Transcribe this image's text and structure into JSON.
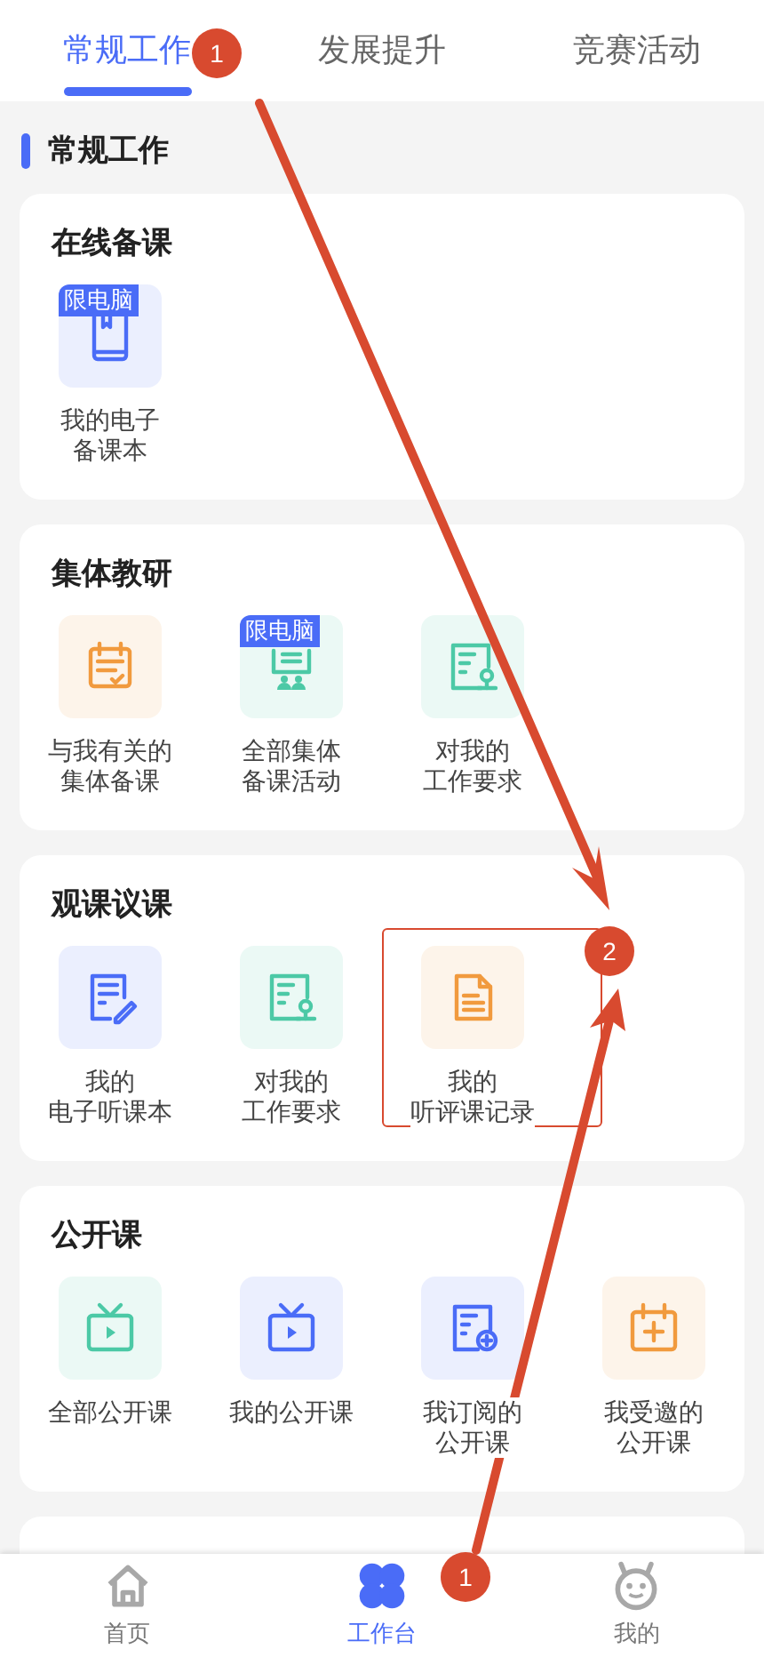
{
  "tabs": [
    {
      "label": "常规工作",
      "selected": true
    },
    {
      "label": "发展提升",
      "selected": false
    },
    {
      "label": "竞赛活动",
      "selected": false
    }
  ],
  "section_title": "常规工作",
  "cards": [
    {
      "title": "在线备课",
      "items": [
        {
          "kind": "book",
          "color": "#4a6cf7",
          "badge": "限电脑",
          "label_lines": [
            "我的电子",
            "备课本"
          ],
          "highlighted": false
        }
      ]
    },
    {
      "title": "集体教研",
      "items": [
        {
          "kind": "calendar-check",
          "color": "#f19a3e",
          "label_lines": [
            "与我有关的",
            "集体备课"
          ],
          "highlighted": false
        },
        {
          "kind": "meeting",
          "color": "#4cc9a6",
          "badge": "限电脑",
          "label_lines": [
            "全部集体",
            "备课活动"
          ],
          "highlighted": false
        },
        {
          "kind": "doc-person",
          "color": "#4cc9a6",
          "label_lines": [
            "对我的",
            "工作要求"
          ],
          "highlighted": false
        }
      ]
    },
    {
      "title": "观课议课",
      "items": [
        {
          "kind": "doc-edit",
          "color": "#4a6cf7",
          "label_lines": [
            "我的",
            "电子听课本"
          ],
          "highlighted": false
        },
        {
          "kind": "doc-person",
          "color": "#4cc9a6",
          "label_lines": [
            "对我的",
            "工作要求"
          ],
          "highlighted": false
        },
        {
          "kind": "doc",
          "color": "#f19a3e",
          "label_lines": [
            "我的",
            "听评课记录"
          ],
          "highlighted": true
        }
      ]
    },
    {
      "title": "公开课",
      "items": [
        {
          "kind": "tv",
          "color": "#4cc9a6",
          "label_lines": [
            "全部公开课"
          ],
          "highlighted": false
        },
        {
          "kind": "tv",
          "color": "#4a6cf7",
          "label_lines": [
            "我的公开课"
          ],
          "highlighted": false
        },
        {
          "kind": "doc-add",
          "color": "#4a6cf7",
          "label_lines": [
            "我订阅的",
            "公开课"
          ],
          "highlighted": false
        },
        {
          "kind": "calendar-add",
          "color": "#f19a3e",
          "label_lines": [
            "我受邀的",
            "公开课"
          ],
          "highlighted": false
        }
      ]
    }
  ],
  "bottom_nav": [
    {
      "kind": "home",
      "label": "首页",
      "selected": false
    },
    {
      "kind": "clover",
      "label": "工作台",
      "selected": true
    },
    {
      "kind": "face",
      "label": "我的",
      "selected": false
    }
  ],
  "annotations": [
    {
      "label": "1"
    },
    {
      "label": "2"
    },
    {
      "label": "1"
    }
  ]
}
